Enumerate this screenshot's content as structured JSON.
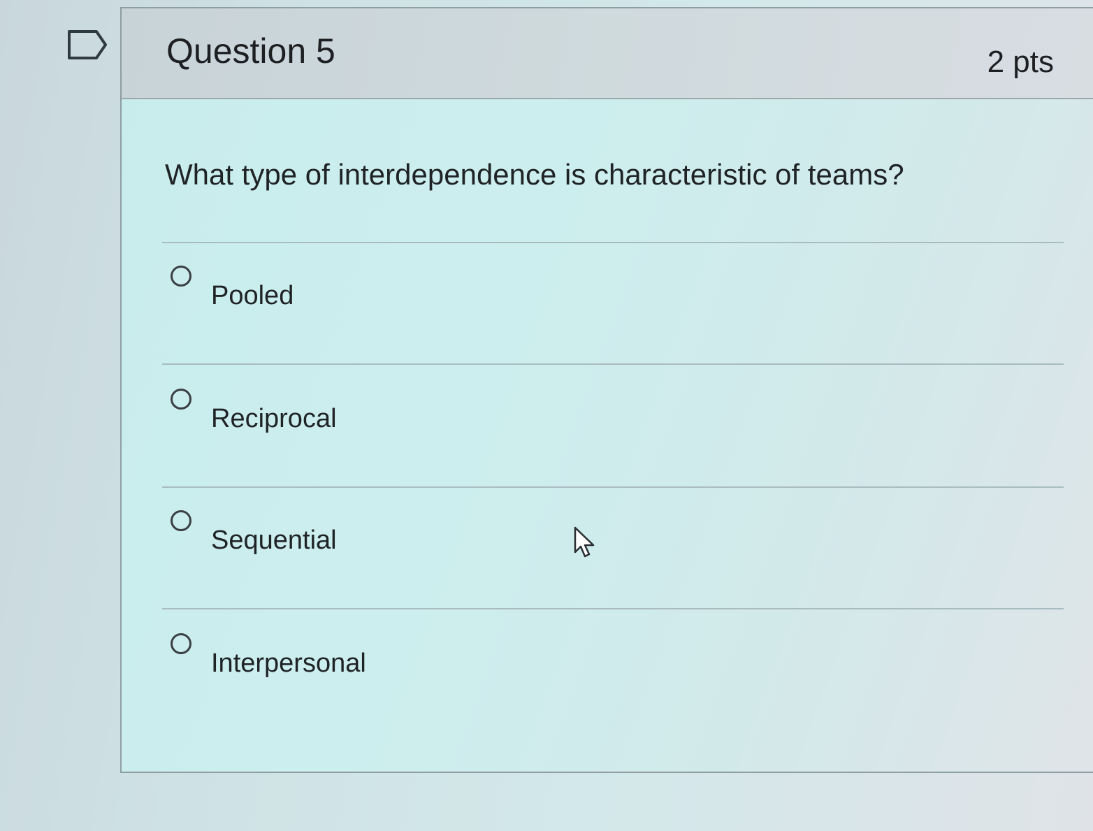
{
  "question": {
    "title": "Question 5",
    "points": "2 pts",
    "prompt": "What type of interdependence is characteristic of teams?"
  },
  "answers": [
    {
      "label": "Pooled",
      "selected": false
    },
    {
      "label": "Reciprocal",
      "selected": false
    },
    {
      "label": "Sequential",
      "selected": false
    },
    {
      "label": "Interpersonal",
      "selected": false
    }
  ],
  "icons": {
    "flag": "flag-icon",
    "radio": "radio-icon",
    "cursor": "mouse-pointer-icon"
  }
}
